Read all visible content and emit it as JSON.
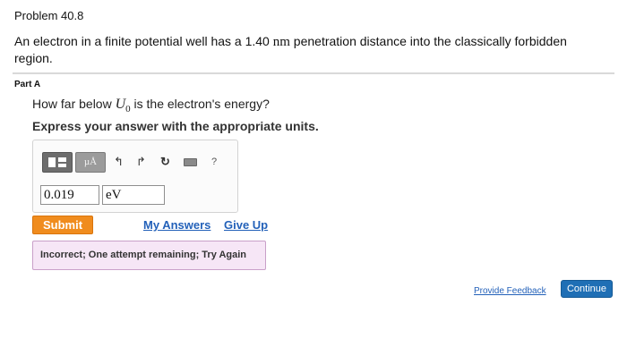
{
  "problem": {
    "title": "Problem 40.8",
    "text_before": "An electron in a finite potential well has a 1.40 ",
    "unit_nm": "nm",
    "text_after": " penetration distance into the classically forbidden region."
  },
  "part": {
    "label": "Part A",
    "question_before": "How far below ",
    "symbol": "U",
    "symbol_sub": "0",
    "question_after": " is the electron's energy?",
    "instruction": "Express your answer with the appropriate units."
  },
  "toolbar": {
    "units_label": "µÅ",
    "undo_icon": "undo-arrow-icon",
    "redo_icon": "redo-arrow-icon",
    "reset_icon": "reset-icon",
    "keyboard_icon": "keyboard-icon",
    "help_label": "?"
  },
  "answer": {
    "value": "0.019",
    "unit": "eV"
  },
  "actions": {
    "submit_label": "Submit",
    "my_answers_label": "My Answers",
    "give_up_label": "Give Up"
  },
  "feedback": {
    "message": "Incorrect; One attempt remaining; Try Again"
  },
  "footer": {
    "provide_feedback_label": "Provide Feedback",
    "continue_label": "Continue"
  },
  "colors": {
    "submit": "#f08c1e",
    "link": "#2361b9",
    "feedback_bg": "#f6e6f6",
    "continue": "#1f6fb5"
  }
}
